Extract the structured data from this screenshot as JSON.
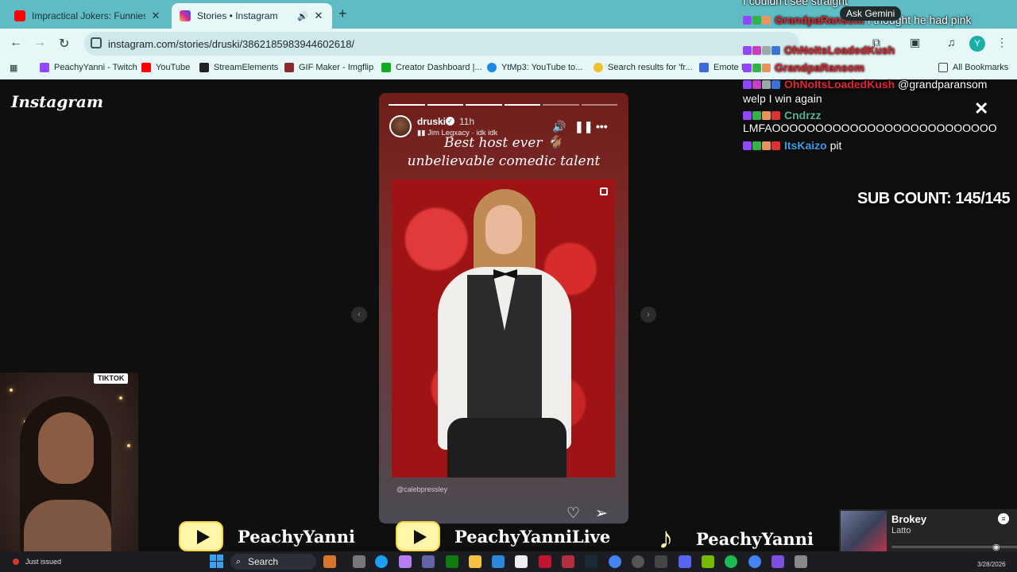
{
  "browser": {
    "tabs": [
      {
        "label": "Impractical Jokers: Funniest Fa",
        "favicon_color": "#ff0000",
        "active": false
      },
      {
        "label": "Stories • Instagram",
        "favicon_color": "#d6249f",
        "active": true
      }
    ],
    "url": "instagram.com/stories/druski/3862185983944602618/",
    "bookmarks": [
      {
        "label": "PeachyYanni - Twitch",
        "icon_color": "#9146ff"
      },
      {
        "label": "YouTube",
        "icon_color": "#ff0000"
      },
      {
        "label": "StreamElements",
        "icon_color": "#222222"
      },
      {
        "label": "GIF Maker - Imgflip",
        "icon_color": "#8a2b2b"
      },
      {
        "label": "Creator Dashboard |...",
        "icon_color": "#11aa22"
      },
      {
        "label": "YtMp3: YouTube to...",
        "icon_color": "#1e88e5"
      },
      {
        "label": "Search results for 'fr...",
        "icon_color": "#f2c12e"
      },
      {
        "label": "Emote M",
        "icon_color": "#3d6ad6"
      }
    ],
    "all_bookmarks": "All Bookmarks",
    "profile_initial": "Y"
  },
  "instagram": {
    "logo": "Instagram",
    "story": {
      "username": "druski",
      "time": "11h",
      "music": "Jim Legxacy · idk idk",
      "caption_line1": "Best host ever 🐐",
      "caption_line2": "unbelievable comedic talent",
      "credit": "@calebpressley",
      "segments_done": 4,
      "segments_total": 6
    }
  },
  "chat": {
    "top_fragment": "I couldn't see straight",
    "gemini_button": "Ask Gemini",
    "messages": [
      {
        "user": "GrandpaRansom",
        "text": "I thought he had pink",
        "color": "#e02830"
      },
      {
        "user": "OhNoItsLoadedKush",
        "text": "",
        "color": "#e02830"
      },
      {
        "user": "GrandpaRansom",
        "text": "",
        "color": "#e02830"
      },
      {
        "user": "OhNoItsLoadedKush",
        "text": "@grandparansom",
        "color": "#e02830"
      },
      {
        "user": "",
        "text": "welp I win again",
        "color": "#ffffff"
      },
      {
        "user": "Cndrzz",
        "text": "",
        "color": "#55b39a"
      },
      {
        "user": "",
        "text": "LMFAOOOOOOOOOOOOOOOOOOOOOOOOOO",
        "color": "#ffffff"
      },
      {
        "user": "ItsKaizo",
        "text": "pit",
        "color": "#38a0e8"
      }
    ],
    "sub_count": "SUB COUNT: 145/145"
  },
  "overlay": {
    "webcam_tag": "TIKTOK",
    "socials": [
      {
        "platform": "youtube",
        "handle": "PeachyYanni"
      },
      {
        "platform": "youtube",
        "handle": "PeachyYanniLive"
      },
      {
        "platform": "tiktok",
        "handle": "PeachyYanni"
      }
    ],
    "now_playing": {
      "title": "Brokey",
      "artist": "Latto"
    }
  },
  "taskbar": {
    "status": "Just issued",
    "search": "Search",
    "date": "3/28/2026"
  }
}
